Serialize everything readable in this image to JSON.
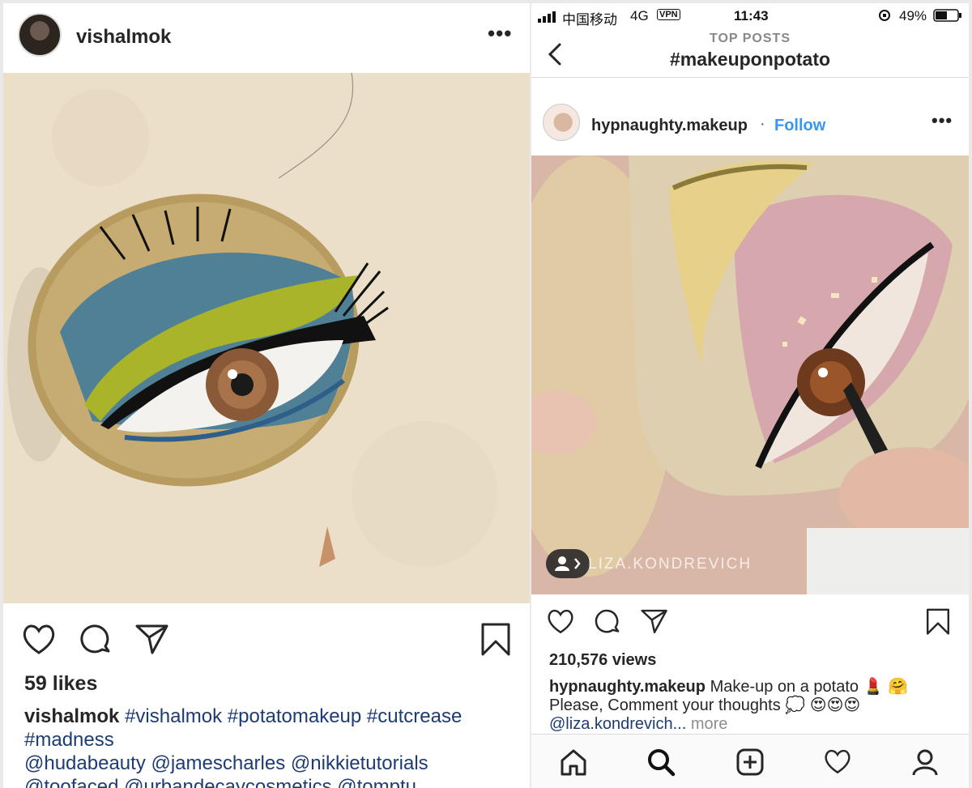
{
  "left_post": {
    "username": "vishalmok",
    "more_label": "•••",
    "likes": "59 likes",
    "caption_user": "vishalmok",
    "caption_line1": "#vishalmok #potatomakeup #cutcrease",
    "caption_line2": "#madness",
    "caption_line3": "@hudabeauty @jamescharles @nikkietutorials",
    "caption_line4": "@toofaced @urbandecaycosmetics @tomptu"
  },
  "status_bar": {
    "carrier": "中国移动",
    "network": "4G",
    "vpn": "VPN",
    "time": "11:43",
    "battery": "49%"
  },
  "nav": {
    "back_label": "‹",
    "subtitle": "TOP POSTS",
    "title": "#makeuponpotato"
  },
  "right_post": {
    "username": "hypnaughty.makeup",
    "separator": "·",
    "follow_label": "Follow",
    "more_label": "•••",
    "watermark": "LIZA.KONDREVICH",
    "views": "210,576 views",
    "caption_user": "hypnaughty.makeup",
    "caption_text": "Make-up on a potato 💄 🤗",
    "caption_line2": "Please, Comment your thoughts 💭 😍😍😍",
    "caption_mention": "@liza.kondrevich...",
    "caption_more": "more"
  },
  "icons": {
    "like": "heart-icon",
    "comment": "comment-icon",
    "share": "send-icon",
    "save": "bookmark-icon",
    "home": "home-icon",
    "search": "search-icon",
    "add": "add-icon",
    "activity": "heart-icon",
    "profile": "profile-icon"
  }
}
